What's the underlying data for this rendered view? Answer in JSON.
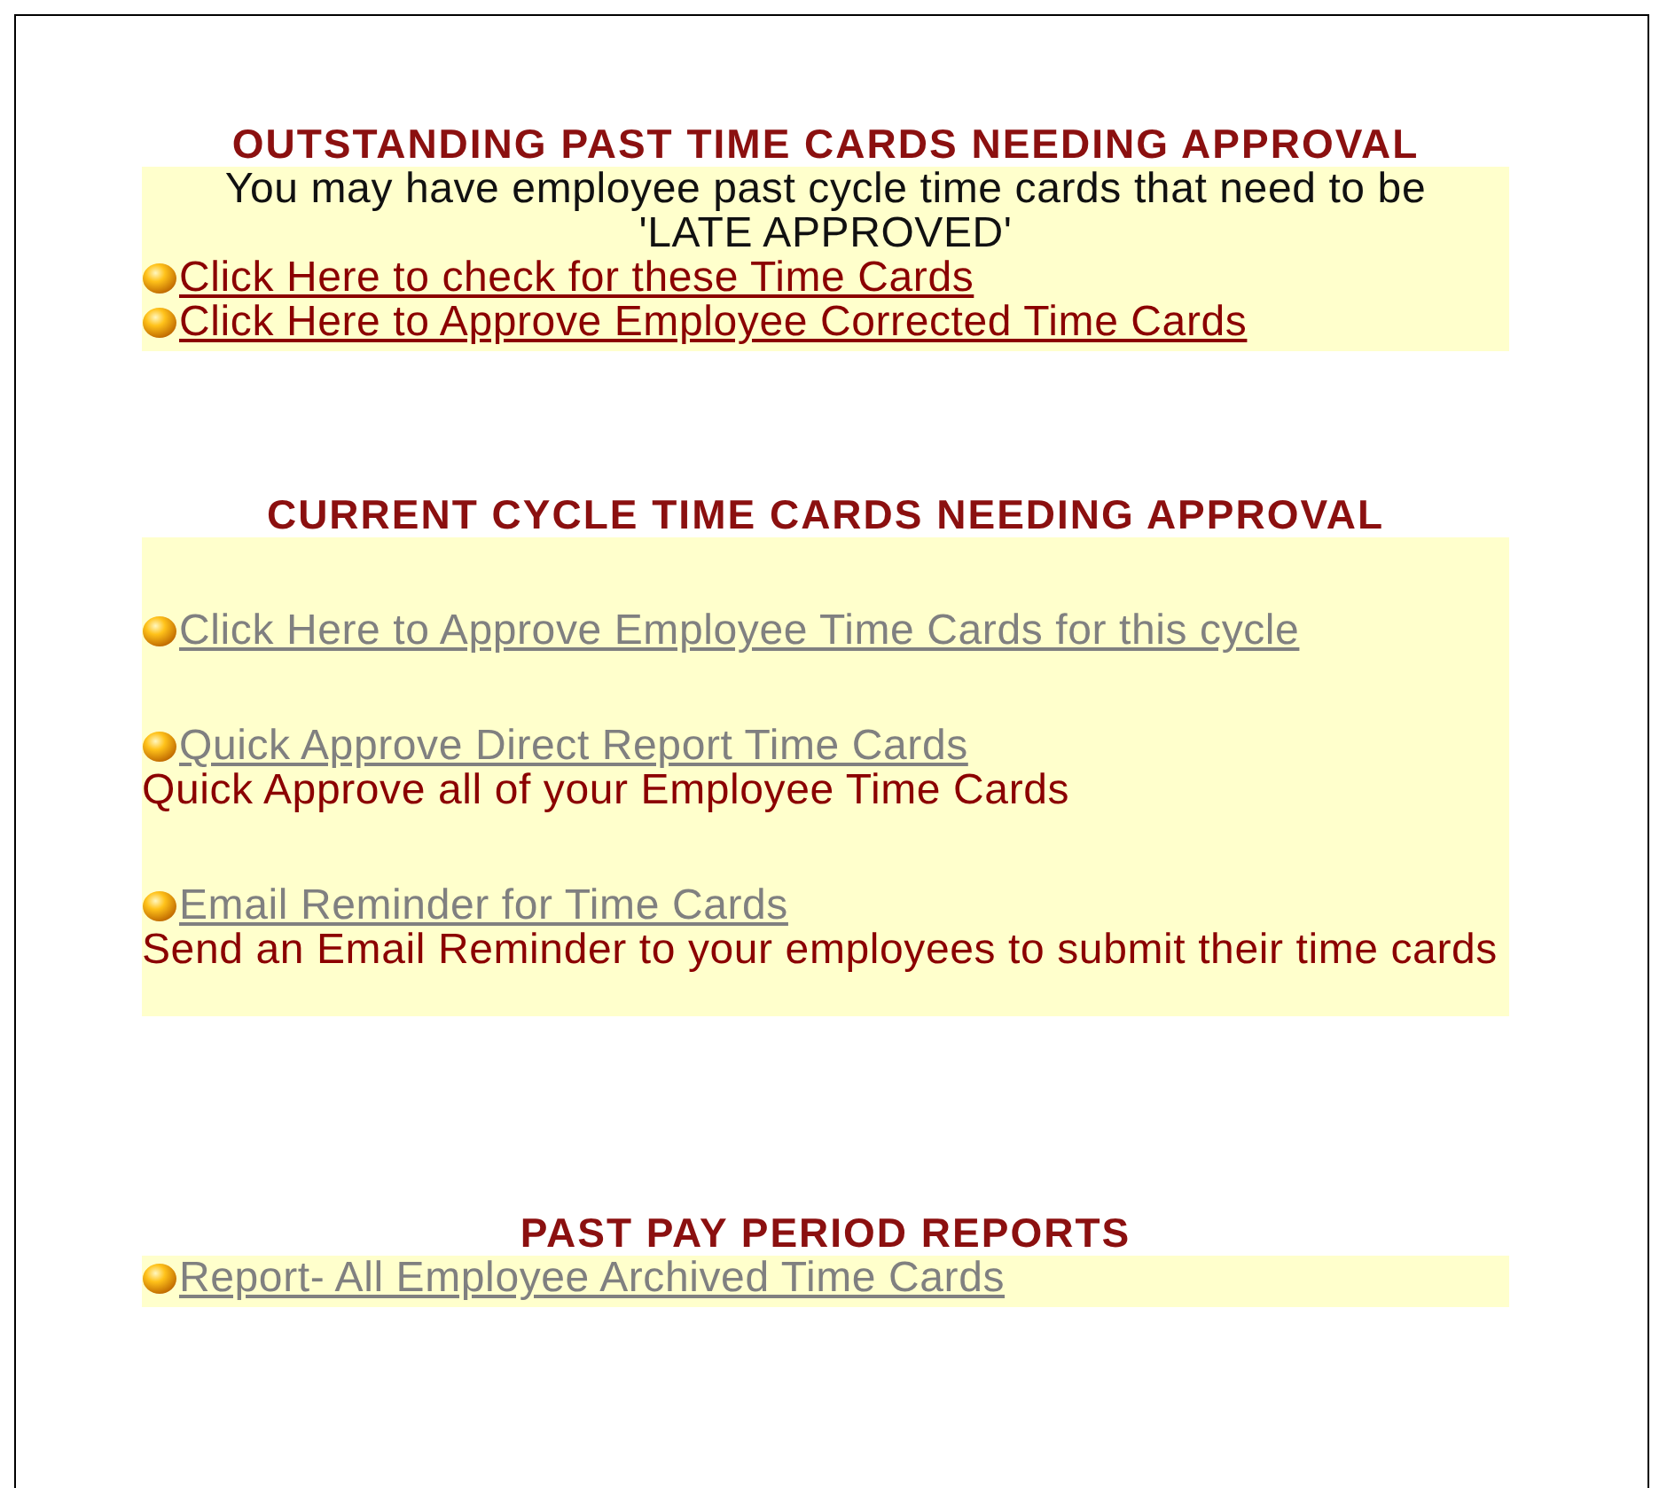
{
  "sections": [
    {
      "heading": "OUTSTANDING PAST TIME CARDS NEEDING APPROVAL",
      "spaced": false,
      "items": [
        {
          "kind": "note",
          "text": "You may have employee past cycle time cards that need to be 'LATE APPROVED'"
        },
        {
          "kind": "link",
          "text": "Click Here to check for these Time Cards",
          "visited": false
        },
        {
          "kind": "link",
          "text": "Click Here to Approve Employee Corrected Time Cards",
          "visited": false
        }
      ]
    },
    {
      "heading": "CURRENT CYCLE TIME CARDS NEEDING APPROVAL",
      "spaced": true,
      "items": [
        {
          "kind": "link",
          "text": "Click Here to Approve Employee Time Cards for this cycle",
          "visited": true
        },
        {
          "kind": "link",
          "text": "Quick Approve Direct Report Time Cards",
          "visited": true
        },
        {
          "kind": "description",
          "text": "Quick Approve all of your Employee Time Cards"
        },
        {
          "kind": "link",
          "text": "Email Reminder for Time Cards",
          "visited": true
        },
        {
          "kind": "description",
          "text": "Send an Email Reminder to your employees to submit their time cards"
        }
      ]
    },
    {
      "heading": "PAST PAY PERIOD REPORTS",
      "spaced": false,
      "items": [
        {
          "kind": "link",
          "text": "Report- All Employee Archived Time Cards",
          "visited": true
        }
      ]
    }
  ]
}
